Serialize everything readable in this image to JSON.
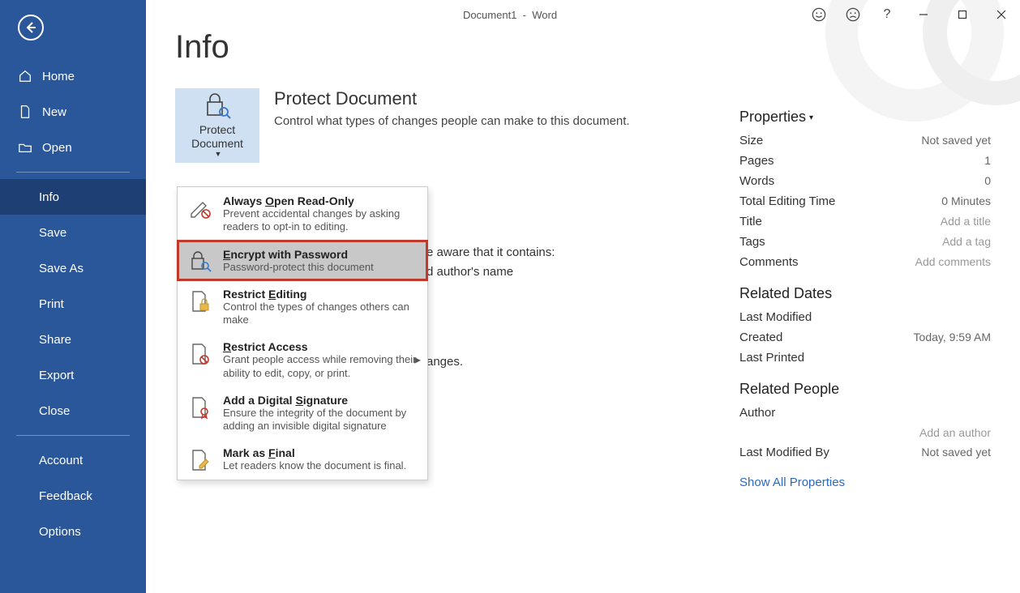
{
  "title": {
    "doc": "Document1",
    "sep": "-",
    "app": "Word",
    "help": "?"
  },
  "sidebar": {
    "home": "Home",
    "new": "New",
    "open": "Open",
    "info": "Info",
    "save": "Save",
    "saveas": "Save As",
    "print": "Print",
    "share": "Share",
    "export": "Export",
    "close": "Close",
    "account": "Account",
    "feedback": "Feedback",
    "options": "Options"
  },
  "page": {
    "heading": "Info"
  },
  "protect": {
    "button": "Protect Document",
    "heading": "Protect Document",
    "desc": "Control what types of changes people can make to this document."
  },
  "dd": {
    "readonly": {
      "t": "Always Open Read-Only",
      "d": "Prevent accidental changes by asking readers to opt-in to editing."
    },
    "encrypt": {
      "t": "Encrypt with Password",
      "d": "Password-protect this document"
    },
    "restrictedit": {
      "t": "Restrict Editing",
      "d": "Control the types of changes others can make"
    },
    "restrictaccess": {
      "t": "Restrict Access",
      "d": "Grant people access while removing their ability to edit, copy, or print."
    },
    "signature": {
      "t": "Add a Digital Signature",
      "d": "Ensure the integrity of the document by adding an invisible digital signature"
    },
    "final": {
      "t": "Mark as Final",
      "d": "Let readers know the document is final."
    }
  },
  "behind": {
    "l1": "e aware that it contains:",
    "l2": "d author's name",
    "l3": "anges."
  },
  "props": {
    "heading": "Properties",
    "size": {
      "k": "Size",
      "v": "Not saved yet"
    },
    "pages": {
      "k": "Pages",
      "v": "1"
    },
    "words": {
      "k": "Words",
      "v": "0"
    },
    "editing": {
      "k": "Total Editing Time",
      "v": "0 Minutes"
    },
    "title": {
      "k": "Title",
      "v": "Add a title"
    },
    "tags": {
      "k": "Tags",
      "v": "Add a tag"
    },
    "comments": {
      "k": "Comments",
      "v": "Add comments"
    },
    "dates": {
      "heading": "Related Dates",
      "lastmod": {
        "k": "Last Modified",
        "v": ""
      },
      "created": {
        "k": "Created",
        "v": "Today, 9:59 AM"
      },
      "printed": {
        "k": "Last Printed",
        "v": ""
      }
    },
    "people": {
      "heading": "Related People",
      "author": {
        "k": "Author",
        "v": ""
      },
      "addauthor": "Add an author",
      "lastmodby": {
        "k": "Last Modified By",
        "v": "Not saved yet"
      }
    },
    "showall": "Show All Properties"
  }
}
